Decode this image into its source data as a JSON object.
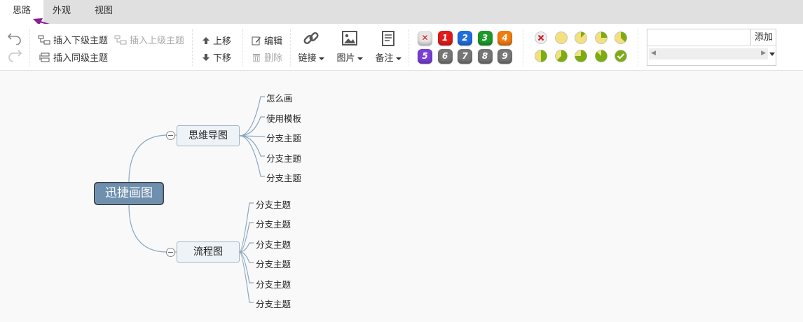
{
  "tabs": [
    {
      "label": "思路",
      "active": true
    },
    {
      "label": "外观",
      "active": false
    },
    {
      "label": "视图",
      "active": false
    }
  ],
  "toolbar": {
    "insert_child": "插入下级主题",
    "insert_parent": "插入上级主题",
    "insert_sibling": "插入同级主题",
    "move_up": "上移",
    "move_down": "下移",
    "edit": "编辑",
    "delete": "删除",
    "link": "链接",
    "image": "图片",
    "note": "备注"
  },
  "priority": {
    "items": [
      {
        "label": "✕",
        "color": "#e6e6e6"
      },
      {
        "label": "1",
        "color": "#e21b1b"
      },
      {
        "label": "2",
        "color": "#1f6fe0"
      },
      {
        "label": "3",
        "color": "#1e9b2a"
      },
      {
        "label": "4",
        "color": "#f07d10"
      },
      {
        "label": "5",
        "color": "#7a3fd6"
      },
      {
        "label": "6",
        "color": "#777777"
      },
      {
        "label": "7",
        "color": "#777777"
      },
      {
        "label": "8",
        "color": "#777777"
      },
      {
        "label": "9",
        "color": "#777777"
      }
    ]
  },
  "progress": {
    "levels": [
      0,
      0,
      0.125,
      0.25,
      0.375,
      0.5,
      0.625,
      0.75,
      0.875,
      1
    ],
    "fill_color": "#7cac13",
    "empty_color": "#f4e07e"
  },
  "resource": {
    "input_value": "",
    "add_label": "添加"
  },
  "mindmap": {
    "root": "迅捷画图",
    "branches": [
      {
        "label": "思维导图",
        "children": [
          "怎么画",
          "使用模板",
          "分支主题",
          "分支主题",
          "分支主题"
        ]
      },
      {
        "label": "流程图",
        "children": [
          "分支主题",
          "分支主题",
          "分支主题",
          "分支主题",
          "分支主题",
          "分支主题"
        ]
      }
    ],
    "line_color": "#8aa7c0"
  },
  "annotation": {
    "arrow_color": "#8a1f8f"
  }
}
